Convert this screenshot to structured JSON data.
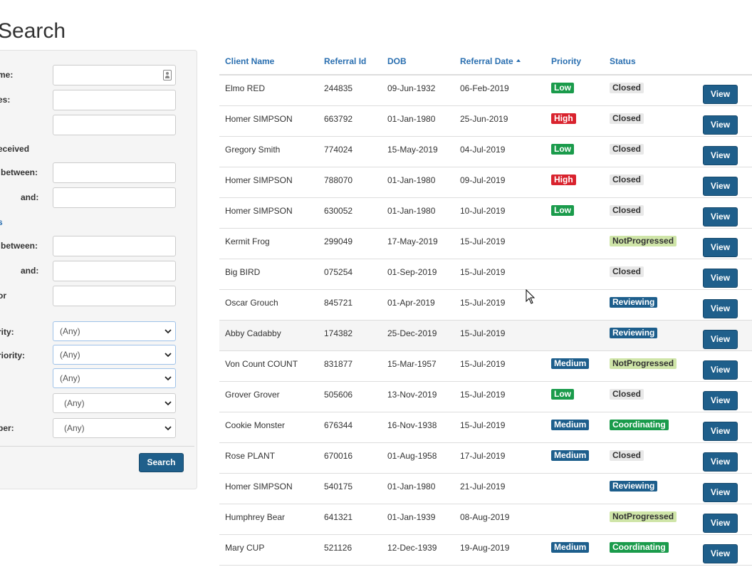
{
  "page": {
    "title": "Search"
  },
  "filters": {
    "labels": {
      "name": "me:",
      "aliases": "es:",
      "date_received": "eceived",
      "received_between": "between:",
      "received_and": "and:",
      "dob_section": "s",
      "dob_between": "between:",
      "dob_and": "and:",
      "worker": "or",
      "priority": "rity:",
      "secondary_priority": "riority:",
      "status": "",
      "team": ":",
      "member": "ber:"
    },
    "values": {
      "name": "",
      "aliases": "",
      "extra": "",
      "received_between": "",
      "received_and": "",
      "dob_between": "",
      "dob_and": "",
      "worker": ""
    },
    "selects": {
      "priority": "(Any)",
      "secondary_priority": "(Any)",
      "status": "(Any)",
      "team": "(Any)",
      "member": "(Any)"
    },
    "search_label": "Search"
  },
  "table": {
    "headers": {
      "client_name": "Client Name",
      "referral_id": "Referral Id",
      "dob": "DOB",
      "referral_date": "Referral Date",
      "priority": "Priority",
      "status": "Status"
    },
    "sort": {
      "column": "Referral Date",
      "direction": "ascending"
    },
    "view_label": "View",
    "rows": [
      {
        "name": "Elmo RED",
        "id": "244835",
        "dob": "09-Jun-1932",
        "ref_date": "06-Feb-2019",
        "priority": "Low",
        "status": "Closed"
      },
      {
        "name": "Homer SIMPSON",
        "id": "663792",
        "dob": "01-Jan-1980",
        "ref_date": "25-Jun-2019",
        "priority": "High",
        "status": "Closed"
      },
      {
        "name": "Gregory Smith",
        "id": "774024",
        "dob": "15-May-2019",
        "ref_date": "04-Jul-2019",
        "priority": "Low",
        "status": "Closed"
      },
      {
        "name": "Homer SIMPSON",
        "id": "788070",
        "dob": "01-Jan-1980",
        "ref_date": "09-Jul-2019",
        "priority": "High",
        "status": "Closed"
      },
      {
        "name": "Homer SIMPSON",
        "id": "630052",
        "dob": "01-Jan-1980",
        "ref_date": "10-Jul-2019",
        "priority": "Low",
        "status": "Closed"
      },
      {
        "name": "Kermit Frog",
        "id": "299049",
        "dob": "17-May-2019",
        "ref_date": "15-Jul-2019",
        "priority": "",
        "status": "NotProgressed"
      },
      {
        "name": "Big BIRD",
        "id": "075254",
        "dob": "01-Sep-2019",
        "ref_date": "15-Jul-2019",
        "priority": "",
        "status": "Closed"
      },
      {
        "name": "Oscar Grouch",
        "id": "845721",
        "dob": "01-Apr-2019",
        "ref_date": "15-Jul-2019",
        "priority": "",
        "status": "Reviewing"
      },
      {
        "name": "Abby Cadabby",
        "id": "174382",
        "dob": "25-Dec-2019",
        "ref_date": "15-Jul-2019",
        "priority": "",
        "status": "Reviewing"
      },
      {
        "name": "Von Count COUNT",
        "id": "831877",
        "dob": "15-Mar-1957",
        "ref_date": "15-Jul-2019",
        "priority": "Medium",
        "status": "NotProgressed"
      },
      {
        "name": "Grover Grover",
        "id": "505606",
        "dob": "13-Nov-2019",
        "ref_date": "15-Jul-2019",
        "priority": "Low",
        "status": "Closed"
      },
      {
        "name": "Cookie Monster",
        "id": "676344",
        "dob": "16-Nov-1938",
        "ref_date": "15-Jul-2019",
        "priority": "Medium",
        "status": "Coordinating"
      },
      {
        "name": "Rose PLANT",
        "id": "670016",
        "dob": "01-Aug-1958",
        "ref_date": "17-Jul-2019",
        "priority": "Medium",
        "status": "Closed"
      },
      {
        "name": "Homer SIMPSON",
        "id": "540175",
        "dob": "01-Jan-1980",
        "ref_date": "21-Jul-2019",
        "priority": "",
        "status": "Reviewing"
      },
      {
        "name": "Humphrey Bear",
        "id": "641321",
        "dob": "01-Jan-1939",
        "ref_date": "08-Aug-2019",
        "priority": "",
        "status": "NotProgressed"
      },
      {
        "name": "Mary CUP",
        "id": "521126",
        "dob": "12-Dec-1939",
        "ref_date": "19-Aug-2019",
        "priority": "Medium",
        "status": "Coordinating"
      }
    ]
  },
  "badge_colors": {
    "Low": {
      "bg": "#1a9b4b",
      "fg": "#ffffff"
    },
    "High": {
      "bg": "#d9232e",
      "fg": "#ffffff"
    },
    "Medium": {
      "bg": "#1d5e8c",
      "fg": "#ffffff"
    },
    "Closed": {
      "bg": "#e8e8e8",
      "fg": "#333333"
    },
    "NotProgressed": {
      "bg": "#cfe5a8",
      "fg": "#333333"
    },
    "Reviewing": {
      "bg": "#1d5e8c",
      "fg": "#ffffff"
    },
    "Coordinating": {
      "bg": "#1a9b4b",
      "fg": "#ffffff"
    }
  },
  "icons": {
    "contact_card": "contact-card-icon",
    "select_arrow": "chevron-down-icon",
    "sort": "sort-ascending-icon",
    "mouse": "mouse-pointer-icon"
  }
}
